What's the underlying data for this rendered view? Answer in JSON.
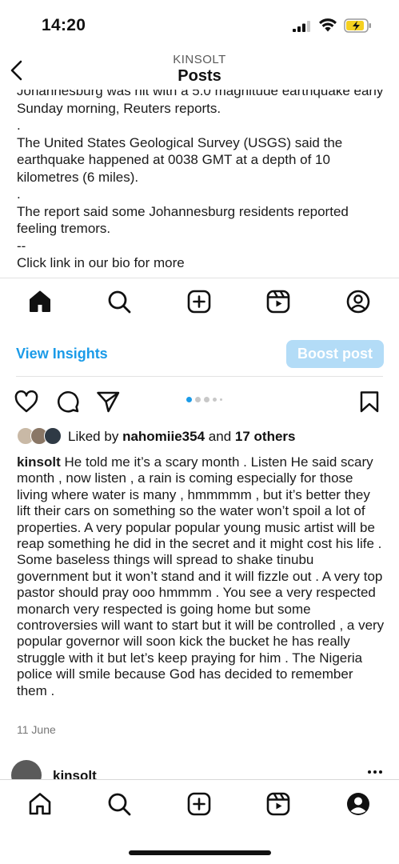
{
  "status_bar": {
    "time": "14:20"
  },
  "header": {
    "account": "KINSOLT",
    "title": "Posts"
  },
  "article": {
    "paragraphs": [
      "Johannesburg was hit with a 5.0 magnitude earthquake early Sunday morning, Reuters reports.",
      ".",
      "The United States Geological Survey (USGS) said the earthquake happened at 0038 GMT at a depth of 10 kilometres (6 miles).",
      ".",
      "The report said some Johannesburg residents reported feeling tremors.",
      "--",
      "Click link in our bio for more"
    ]
  },
  "insights": {
    "view_label": "View Insights",
    "boost_label": "Boost post"
  },
  "carousel": {
    "total": 5,
    "active_index": 0
  },
  "likes": {
    "prefix": "Liked by",
    "user": "nahomiie354",
    "connector": "and",
    "others": "17 others"
  },
  "caption": {
    "username": "kinsolt",
    "text": "He told me it’s a scary month .  Listen He said scary month , now listen , a rain is coming especially for those living where water is many , hmmmmm , but it’s better they lift their cars on something so the water won’t spoil a lot of properties.  A very popular popular young music artist will be reap something he did in the secret and it might cost his life .  Some baseless things will spread to shake tinubu government but it won’t stand and it will fizzle out .  A very top pastor should pray ooo hmmmm .  You see a very respected monarch very respected is going home but some controversies will want to start but it will be controlled ,  a very popular governor will soon kick the bucket he has really struggle with it but let’s keep praying for him .  The Nigeria police will smile because God has decided to remember them ."
  },
  "post_date": "11 June",
  "next_post": {
    "username": "kinsolt"
  },
  "colors": {
    "accent": "#1b9be8",
    "boost_bg": "#b3dcf7",
    "battery": "#f5d020"
  },
  "icons": {
    "top_tabs": [
      "home-filled-icon",
      "search-icon",
      "create-icon",
      "reels-icon",
      "profile-icon"
    ],
    "actions": [
      "heart-icon",
      "comment-icon",
      "share-icon",
      "bookmark-icon"
    ],
    "bottom_tabs": [
      "home-outline-icon",
      "search-icon",
      "create-icon",
      "reels-icon",
      "profile-filled-icon"
    ]
  }
}
